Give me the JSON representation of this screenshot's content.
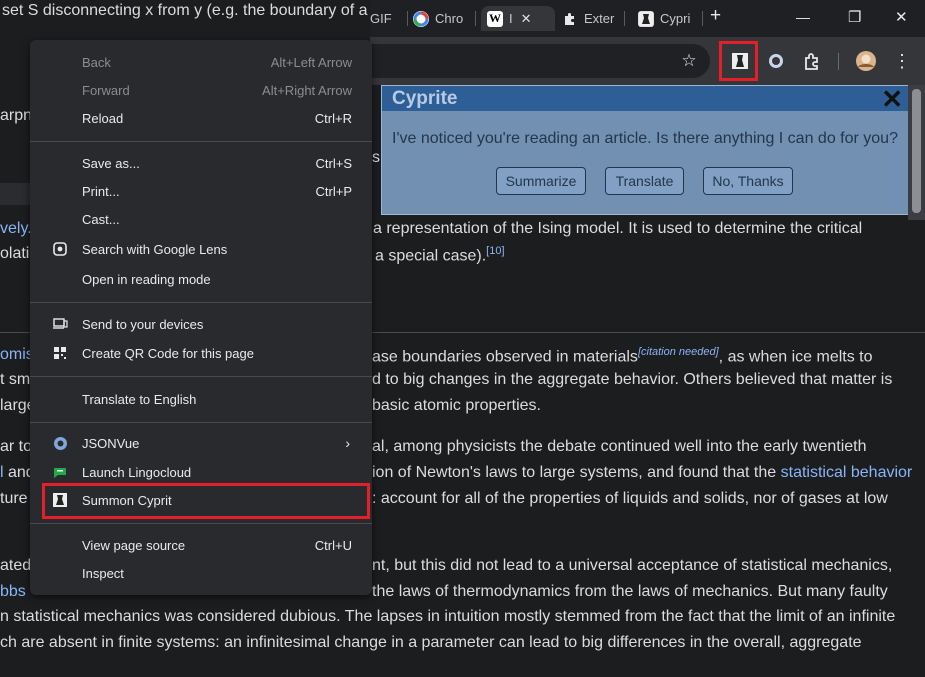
{
  "article": {
    "line_top": "set S disconnecting x from y (e.g. the boundary of a",
    "frag_arpn": "arpn",
    "frag_s": "s",
    "line1_start": "vely.",
    "line1_end": "a representation of the Ising model. It is used to determine the critical",
    "line2_start": "olatio",
    "line2_end": "a special case).",
    "ref10": "[10]",
    "line3_start": "omisi",
    "line3_mid": "ase boundaries observed in materials",
    "citation": "[citation needed]",
    "line3_end": ", as when ice melts to",
    "line4_start": "t sm",
    "line4_end": "d to big changes in the aggregate behavior. Others believed that matter is",
    "line5_start": "large",
    "line5_end": "basic atomic properties.",
    "line6_start": "ar to",
    "line6_end": "al, among physicists the debate continued well into the early twentieth",
    "line7_start": "l",
    "line7_start2": " and",
    "line7_mid": "ion of Newton's laws to large systems, and found that the",
    "line7_link": "statistical behavior",
    "line8_start": "ture",
    "line8_end": ": account for all of the properties of liquids and solids, nor of gases at low",
    "line9_start": "ated,",
    "line9_end": "nt, but this did not lead to a universal acceptance of statistical mechanics,",
    "line10_link": "bbs",
    "line10_end": "the laws of thermodynamics from the laws of mechanics. But many faulty",
    "line11": "n statistical mechanics was considered dubious. The lapses in intuition mostly stemmed from the fact that the limit of an infinite",
    "line12": "ch are absent in finite systems: an infinitesimal change in a parameter can lead to big differences in the overall, aggregate"
  },
  "tabs": [
    {
      "label": "GIF",
      "icon": "gif-favicon"
    },
    {
      "label": "Chro",
      "icon": "google-icon"
    },
    {
      "label": "I",
      "icon": "wikipedia-icon",
      "active": true
    },
    {
      "label": "Exter",
      "icon": "puzzle-icon"
    },
    {
      "label": "Cypri",
      "icon": "cyprite-icon"
    }
  ],
  "window_controls": {
    "new_tab": "+",
    "minimize": "—",
    "restore": "❐",
    "close": "✕"
  },
  "toolbar": {
    "bookmark": "☆",
    "more": "⋮"
  },
  "popup": {
    "title": "Cyprite",
    "close": "✕",
    "message": "I've noticed you're reading an article. Is there anything I can do for you?",
    "buttons": [
      "Summarize",
      "Translate",
      "No, Thanks"
    ]
  },
  "menu": {
    "items": [
      {
        "label": "Back",
        "shortcut": "Alt+Left Arrow",
        "disabled": true
      },
      {
        "label": "Forward",
        "shortcut": "Alt+Right Arrow",
        "disabled": true
      },
      {
        "label": "Reload",
        "shortcut": "Ctrl+R"
      },
      {
        "label": "Save as...",
        "shortcut": "Ctrl+S"
      },
      {
        "label": "Print...",
        "shortcut": "Ctrl+P"
      },
      {
        "label": "Cast..."
      },
      {
        "label": "Search with Google Lens",
        "icon": "lens-icon"
      },
      {
        "label": "Open in reading mode"
      },
      {
        "label": "Send to your devices",
        "icon": "devices-icon"
      },
      {
        "label": "Create QR Code for this page",
        "icon": "qr-code-icon"
      },
      {
        "label": "Translate to English"
      },
      {
        "label": "JSONVue",
        "icon": "jsonvue-icon",
        "submenu": "›"
      },
      {
        "label": "Launch Lingocloud",
        "icon": "lingocloud-icon"
      },
      {
        "label": "Summon Cyprit",
        "icon": "cyprite-icon",
        "highlighted": true
      },
      {
        "label": "View page source",
        "shortcut": "Ctrl+U"
      },
      {
        "label": "Inspect"
      }
    ]
  },
  "colors": {
    "highlight": "#e3202a",
    "menu_bg": "#292a2d",
    "popup_header": "#2e5e96",
    "link": "#8ab4f8"
  }
}
